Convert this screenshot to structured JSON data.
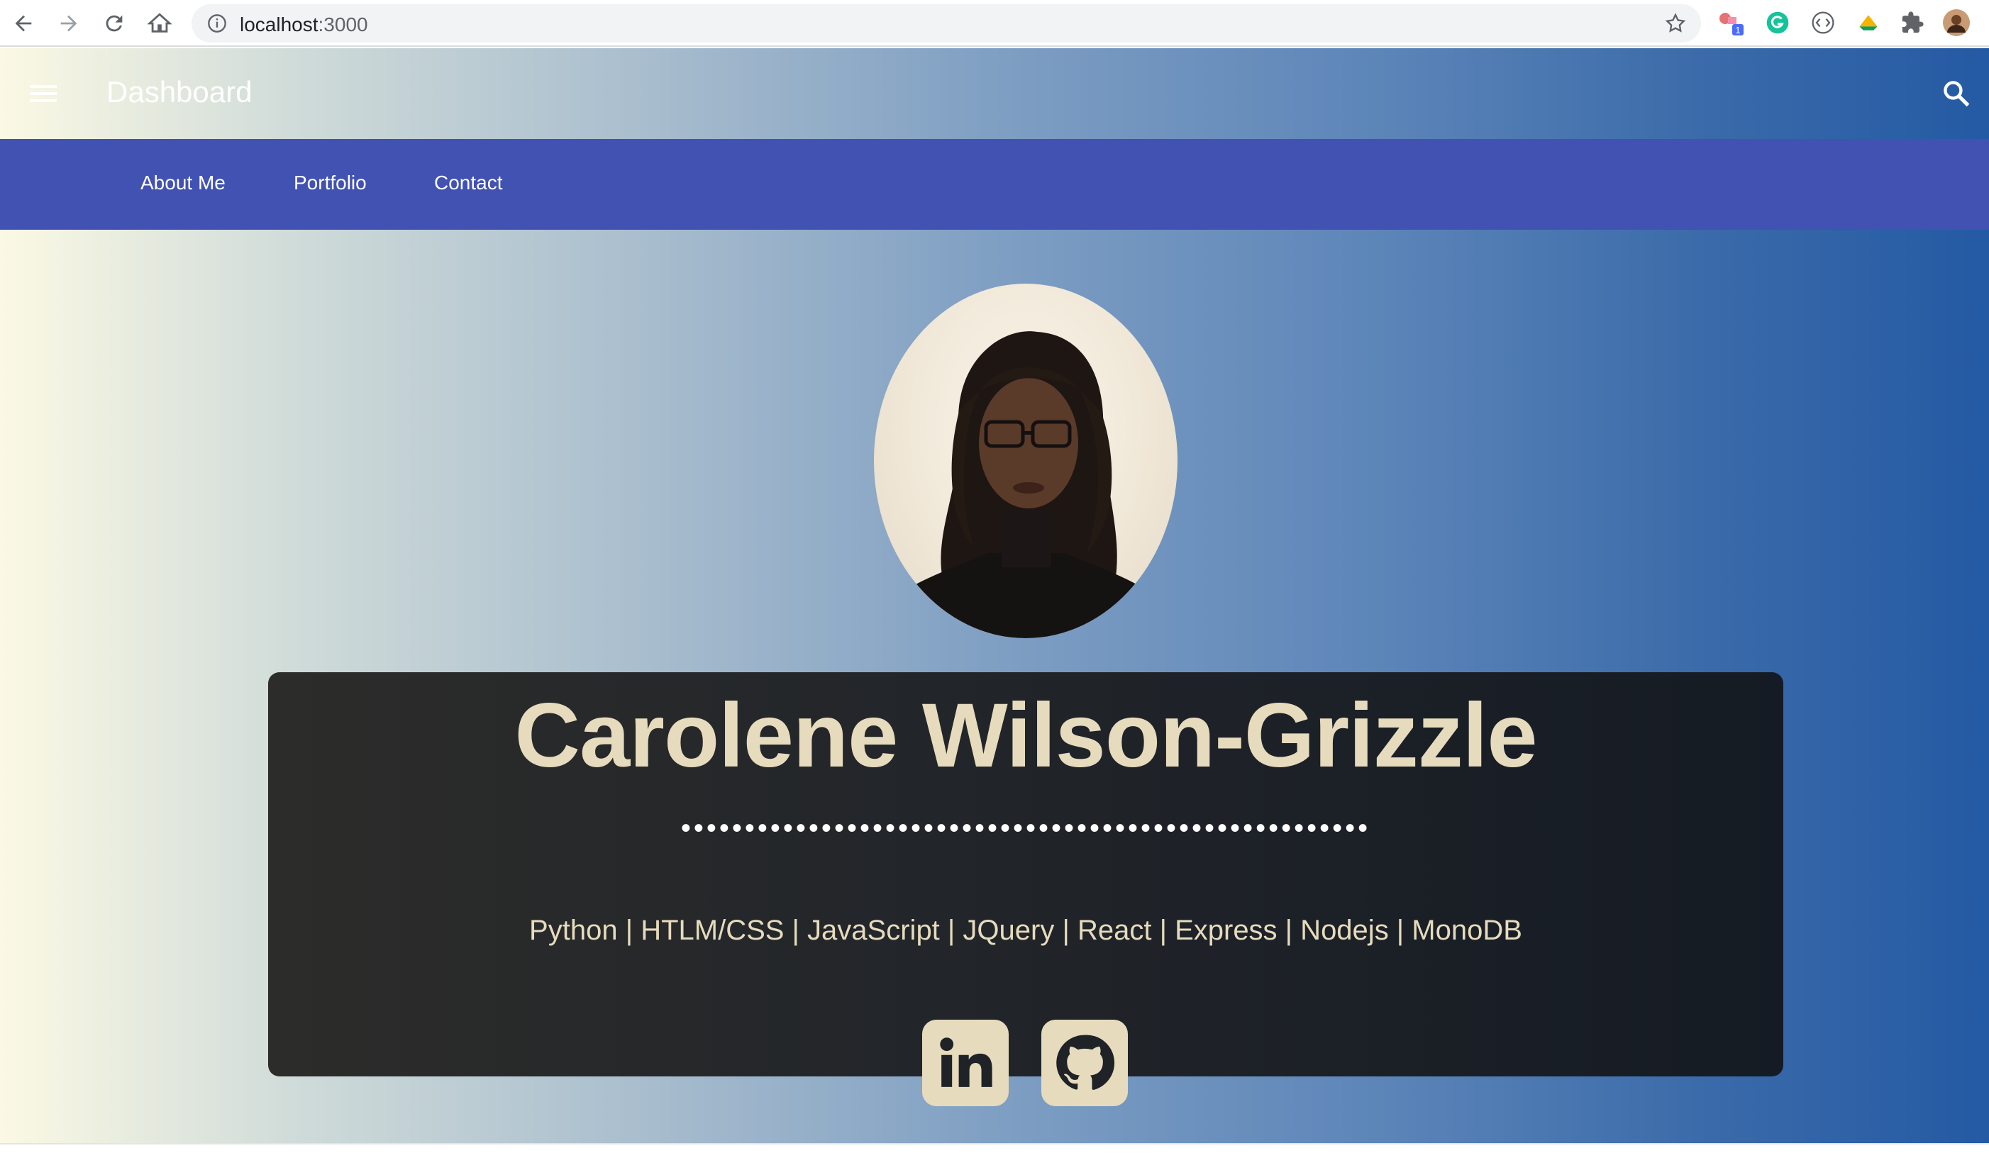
{
  "browser": {
    "url_host": "localhost",
    "url_port": ":3000",
    "extension_badge": "1"
  },
  "appbar": {
    "title": "Dashboard"
  },
  "tabs": [
    {
      "label": "About Me"
    },
    {
      "label": "Portfolio"
    },
    {
      "label": "Contact"
    }
  ],
  "profile": {
    "name": "Carolene Wilson-Grizzle",
    "divider": "••••••••••••••••••••••••••••••••••••••••••••••••••••••",
    "skills": "Python | HTLM/CSS | JavaScript | JQuery | React | Express | Nodejs | MonoDB",
    "social": [
      {
        "icon": "linkedin-icon"
      },
      {
        "icon": "github-icon"
      }
    ]
  },
  "colors": {
    "tabbar": "#4152b3",
    "card_text": "#e6dbbd",
    "card_bg": "#23262a"
  }
}
